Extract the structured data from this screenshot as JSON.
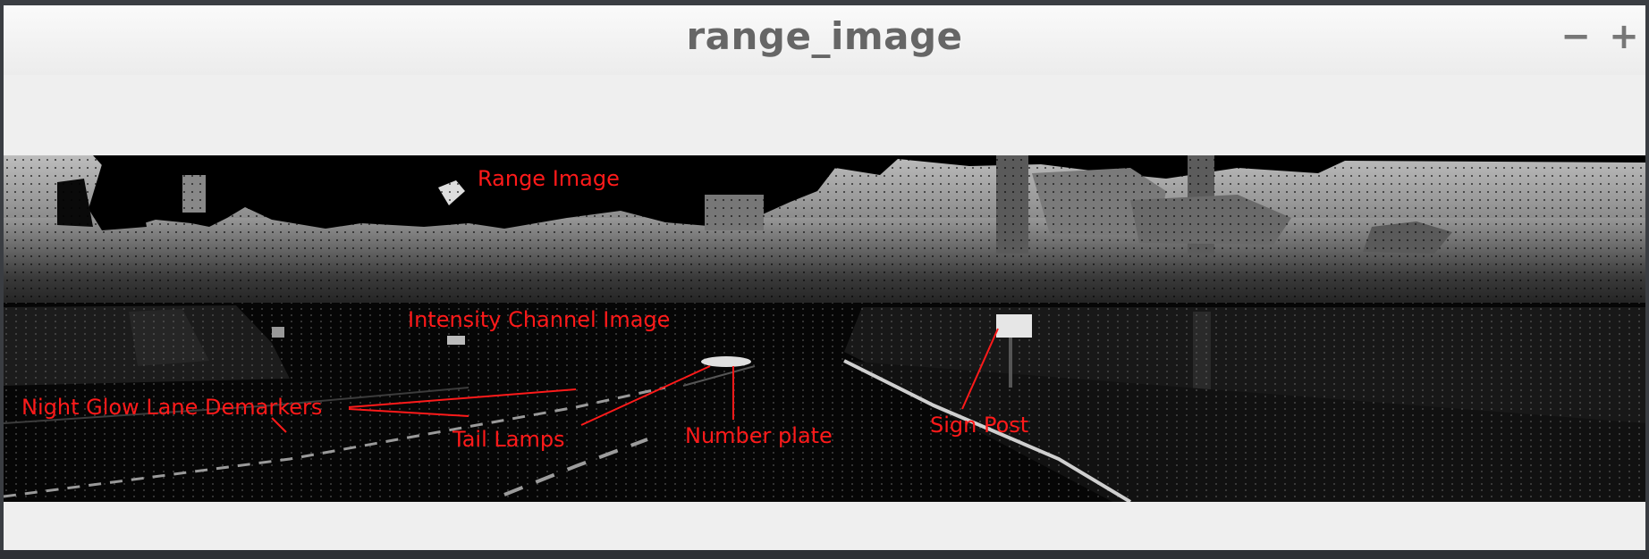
{
  "window": {
    "title": "range_image",
    "minimize_label": "−",
    "zoom_in_label": "+"
  },
  "image": {
    "labels": {
      "range_image": "Range Image",
      "intensity_image": "Intensity Channel Image",
      "lane_demarkers": "Night Glow Lane Demarkers",
      "tail_lamps": "Tail Lamps",
      "number_plate": "Number plate",
      "sign_post": "Sign Post"
    },
    "annotation_color": "#ff1a1a"
  }
}
